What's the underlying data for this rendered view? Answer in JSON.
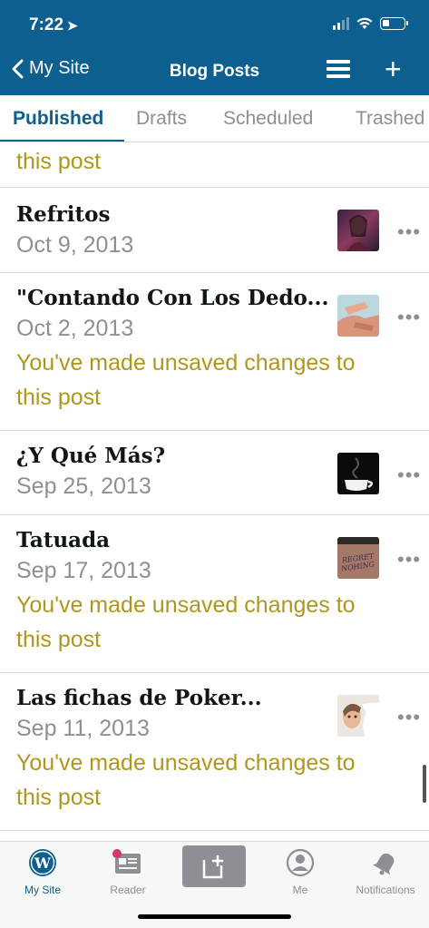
{
  "status": {
    "time": "7:22",
    "battery_level": 0.35
  },
  "nav": {
    "back_label": "My Site",
    "title": "Blog Posts"
  },
  "tabs": [
    {
      "label": "Published"
    },
    {
      "label": "Drafts"
    },
    {
      "label": "Scheduled"
    },
    {
      "label": "Trashed"
    }
  ],
  "partial_warning": "this post",
  "posts": [
    {
      "title": "Refritos",
      "date": "Oct 9, 2013",
      "warning1": "",
      "warning2": ""
    },
    {
      "title": "\"Contando Con Los Dedo...",
      "date": "Oct 2, 2013",
      "warning1": "You've made unsaved changes to",
      "warning2": "this post"
    },
    {
      "title": "¿Y Qué Más?",
      "date": "Sep 25, 2013",
      "warning1": "",
      "warning2": ""
    },
    {
      "title": "Tatuada",
      "date": "Sep 17, 2013",
      "warning1": "You've made unsaved changes to",
      "warning2": "this post"
    },
    {
      "title": "Las fichas de Poker...",
      "date": "Sep 11, 2013",
      "warning1": "You've made unsaved changes to",
      "warning2": "this post"
    }
  ],
  "tattoo_text": "REGRET NOTHING",
  "more_label": "•••",
  "tabbar": {
    "my_site": "My Site",
    "reader": "Reader",
    "me": "Me",
    "notifications": "Notifications"
  },
  "colors": {
    "brand": "#0d5f8f",
    "warning": "#b0961a",
    "muted": "#8c8f94"
  }
}
